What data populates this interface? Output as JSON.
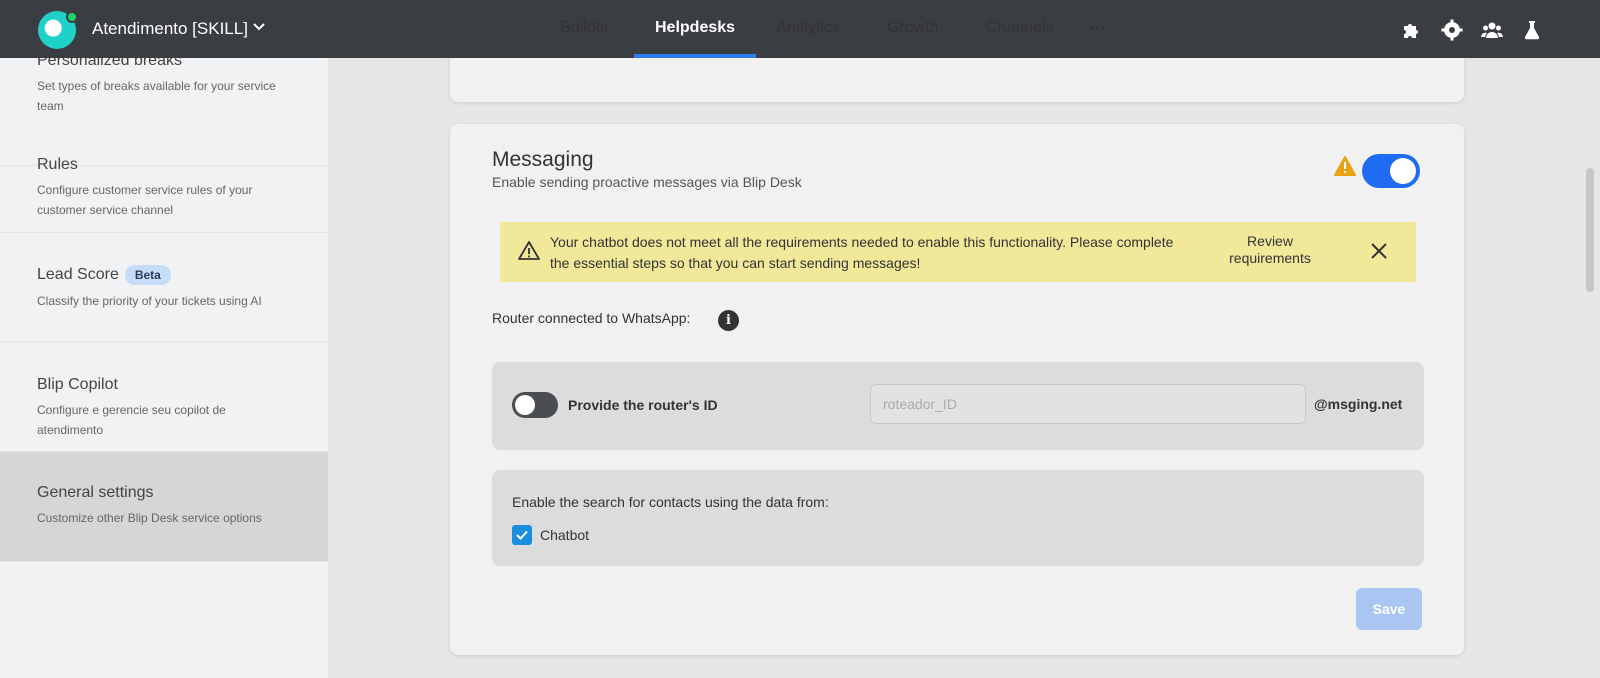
{
  "colors": {
    "topbar_bg": "#3a3d42",
    "accent": "#1f6bf2",
    "alert_bg": "#f2e89a",
    "warning": "#e8a317",
    "checkbox": "#1a8fe0"
  },
  "topbar": {
    "app_title": "Atendimento [SKILL]",
    "nav": [
      "Builder",
      "Helpdesks",
      "Analytics",
      "Growth",
      "Channels"
    ],
    "active_nav": "Helpdesks",
    "more_glyph": "•••",
    "icons": [
      "puzzle-icon",
      "gear-icon",
      "users-icon",
      "flask-icon"
    ]
  },
  "sidebar": {
    "items": [
      {
        "title": "Personalized breaks",
        "desc": "Set types of breaks available for your service team"
      },
      {
        "title": "Rules",
        "desc": "Configure customer service rules of your customer service channel"
      },
      {
        "title": "Lead Score",
        "badge": "Beta",
        "desc": "Classify the priority of your tickets using AI"
      },
      {
        "title": "Blip Copilot",
        "desc": "Configure e gerencie seu copilot de atendimento"
      },
      {
        "title": "General settings",
        "desc": "Customize other Blip Desk service options"
      }
    ]
  },
  "messaging": {
    "title": "Messaging",
    "subtitle": "Enable sending proactive messages via Blip Desk",
    "enabled": true,
    "alert": {
      "text": "Your chatbot does not meet all the requirements needed to enable this functionality. Please complete the essential steps so that you can start sending messages!",
      "review_label": "Review requirements"
    },
    "router_label": "Router connected to WhatsApp:",
    "info_glyph": "i",
    "provide_label": "Provide the router's ID",
    "router_placeholder": "roteador_ID",
    "domain": "@msging.net",
    "search_label": "Enable the search for contacts using the data from:",
    "chatbot_label": "Chatbot",
    "chatbot_checked": true,
    "save_label": "Save"
  }
}
